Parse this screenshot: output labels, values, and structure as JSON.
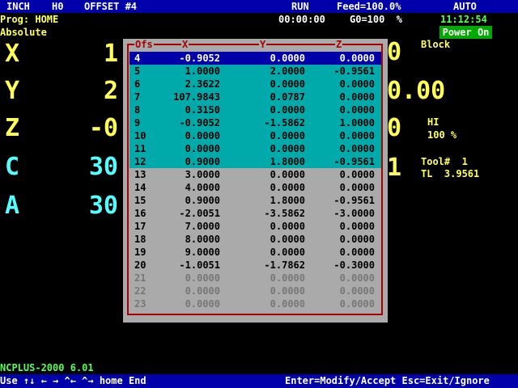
{
  "status_bar": {
    "units": "INCH",
    "h_code": "H0",
    "offset": "OFFSET #4",
    "run_state": "RUN",
    "feed": "Feed=100.0%",
    "mode": "AUTO"
  },
  "info": {
    "program": "Prog: HOME",
    "timer": "00:00:00",
    "g0": "G0=100  %",
    "clock": "11:12:54",
    "coord_mode": "Absolute",
    "power": "Power On"
  },
  "axes": [
    {
      "letter": "X",
      "value": "1"
    },
    {
      "letter": "Y",
      "value": "2"
    },
    {
      "letter": "Z",
      "value": "-0"
    },
    {
      "letter": "C",
      "value": "30"
    },
    {
      "letter": "A",
      "value": "30"
    }
  ],
  "right_panel": {
    "block_label": "Block",
    "col_digits": [
      "0",
      "0.00",
      "0",
      "1"
    ],
    "speed_label": "HI",
    "speed_value": "100 %",
    "tool_label": "Tool#  1",
    "tl_label": "TL  3.9561"
  },
  "offset_table": {
    "headers": {
      "ofs": "Ofs",
      "x": "X",
      "y": "Y",
      "z": "Z"
    },
    "rows": [
      {
        "ofs": "4",
        "x": "-0.9052",
        "y": "0.0000",
        "z": "0.0000"
      },
      {
        "ofs": "5",
        "x": "1.0000",
        "y": "2.0000",
        "z": "-0.9561"
      },
      {
        "ofs": "6",
        "x": "2.3622",
        "y": "0.0000",
        "z": "0.0000"
      },
      {
        "ofs": "7",
        "x": "107.9843",
        "y": "0.0787",
        "z": "0.0000"
      },
      {
        "ofs": "8",
        "x": "0.3150",
        "y": "0.0000",
        "z": "0.0000"
      },
      {
        "ofs": "9",
        "x": "-0.9052",
        "y": "-1.5862",
        "z": "1.0000"
      },
      {
        "ofs": "10",
        "x": "0.0000",
        "y": "0.0000",
        "z": "0.0000"
      },
      {
        "ofs": "11",
        "x": "0.0000",
        "y": "0.0000",
        "z": "0.0000"
      },
      {
        "ofs": "12",
        "x": "0.9000",
        "y": "1.8000",
        "z": "-0.9561"
      },
      {
        "ofs": "13",
        "x": "3.0000",
        "y": "0.0000",
        "z": "0.0000"
      },
      {
        "ofs": "14",
        "x": "4.0000",
        "y": "0.0000",
        "z": "0.0000"
      },
      {
        "ofs": "15",
        "x": "0.9000",
        "y": "1.8000",
        "z": "-0.9561"
      },
      {
        "ofs": "16",
        "x": "-2.0051",
        "y": "-3.5862",
        "z": "-3.0000"
      },
      {
        "ofs": "17",
        "x": "7.0000",
        "y": "0.0000",
        "z": "0.0000"
      },
      {
        "ofs": "18",
        "x": "8.0000",
        "y": "0.0000",
        "z": "0.0000"
      },
      {
        "ofs": "19",
        "x": "9.0000",
        "y": "0.0000",
        "z": "0.0000"
      },
      {
        "ofs": "20",
        "x": "-1.0051",
        "y": "-1.7862",
        "z": "-0.3000"
      },
      {
        "ofs": "21",
        "x": "0.0000",
        "y": "0.0000",
        "z": "0.0000"
      },
      {
        "ofs": "22",
        "x": "0.0000",
        "y": "0.0000",
        "z": "0.0000"
      },
      {
        "ofs": "23",
        "x": "0.0000",
        "y": "0.0000",
        "z": "0.0000"
      }
    ]
  },
  "footer": {
    "version": "NCPLUS-2000 6.01",
    "help_left": "Use ↑↓ ← → ^← ^→ home End",
    "help_right": "Enter=Modify/Accept Esc=Exit/Ignore"
  },
  "colors": {
    "background": "#000000",
    "bar_blue": "#0000aa",
    "axis_yellow": "#ffff55",
    "axis_cyan": "#55ffff",
    "popup_gray": "#aaaaaa",
    "highlight_teal": "#00aaaa",
    "frame_red": "#aa0000",
    "power_green": "#00aa00"
  }
}
